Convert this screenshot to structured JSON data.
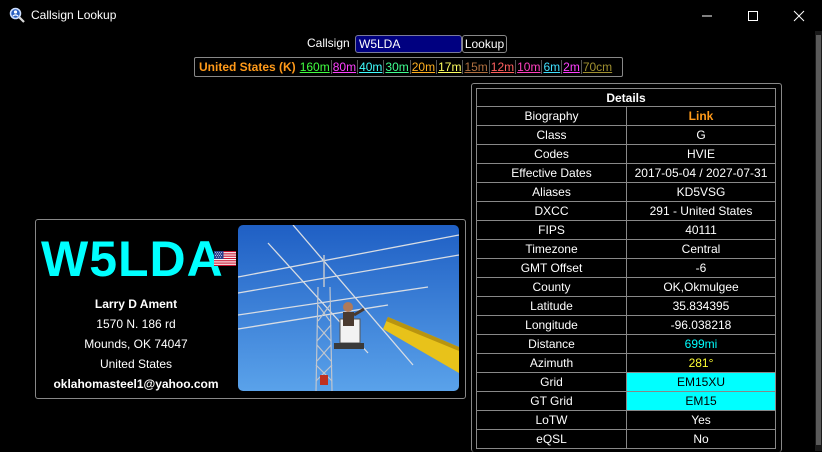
{
  "window": {
    "title": "Callsign Lookup"
  },
  "lookup": {
    "label": "Callsign",
    "value": "W5LDA",
    "button_label": "Lookup"
  },
  "bands": {
    "country": "United States (K)",
    "items": [
      {
        "label": "160m",
        "color": "#40ff40"
      },
      {
        "label": "80m",
        "color": "#ff40ff"
      },
      {
        "label": "40m",
        "color": "#40ffff"
      },
      {
        "label": "30m",
        "color": "#40ff90"
      },
      {
        "label": "20m",
        "color": "#ffb020"
      },
      {
        "label": "17m",
        "color": "#ffff60"
      },
      {
        "label": "15m",
        "color": "#b07040"
      },
      {
        "label": "12m",
        "color": "#ff6060"
      },
      {
        "label": "10m",
        "color": "#ff40c0"
      },
      {
        "label": "6m",
        "color": "#40e0ff"
      },
      {
        "label": "2m",
        "color": "#ff40ff"
      },
      {
        "label": "70cm",
        "color": "#a09030"
      }
    ]
  },
  "card": {
    "callsign": "W5LDA",
    "flag": "us-flag-icon",
    "name": "Larry D Ament",
    "street": "1570 N. 186 rd",
    "city": "Mounds, OK 74047",
    "country": "United States",
    "email": "oklahomasteel1@yahoo.com"
  },
  "details": {
    "header": "Details",
    "rows": [
      {
        "key": "Biography",
        "value": "Link"
      },
      {
        "key": "Class",
        "value": "G"
      },
      {
        "key": "Codes",
        "value": "HVIE"
      },
      {
        "key": "Effective Dates",
        "value": "2017-05-04 / 2027-07-31"
      },
      {
        "key": "Aliases",
        "value": "KD5VSG"
      },
      {
        "key": "DXCC",
        "value": "291 - United States"
      },
      {
        "key": "FIPS",
        "value": "40111"
      },
      {
        "key": "Timezone",
        "value": "Central"
      },
      {
        "key": "GMT Offset",
        "value": "-6"
      },
      {
        "key": "County",
        "value": "OK,Okmulgee"
      },
      {
        "key": "Latitude",
        "value": "35.834395"
      },
      {
        "key": "Longitude",
        "value": "-96.038218"
      },
      {
        "key": "Distance",
        "value": "699mi"
      },
      {
        "key": "Azimuth",
        "value": "281°"
      },
      {
        "key": "Grid",
        "value": "EM15XU"
      },
      {
        "key": "GT Grid",
        "value": "EM15"
      },
      {
        "key": "LoTW",
        "value": "Yes"
      },
      {
        "key": "eQSL",
        "value": "No"
      }
    ]
  }
}
